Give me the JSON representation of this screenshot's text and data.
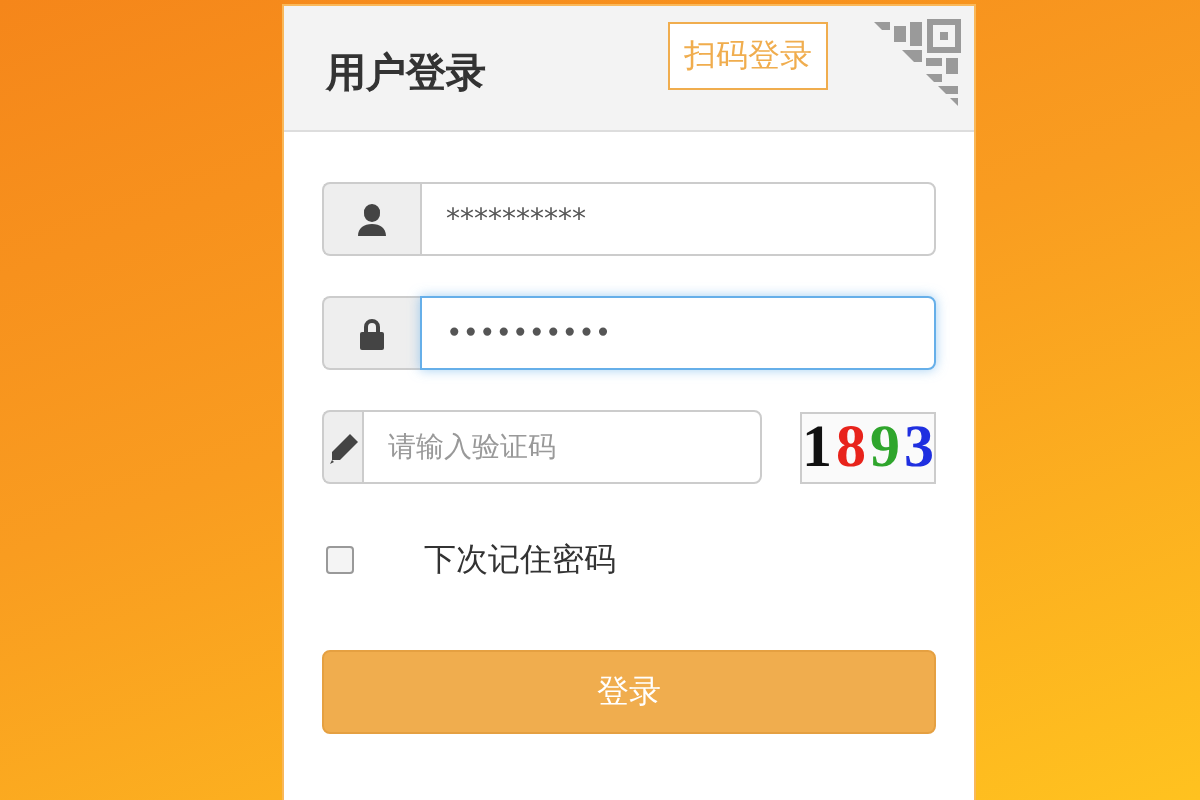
{
  "header": {
    "title": "用户登录",
    "qr_tag": "扫码登录"
  },
  "fields": [
    {
      "kind": "user",
      "value": "**********",
      "focused": false
    },
    {
      "kind": "lock",
      "value": "••••••••••",
      "focused": true
    }
  ],
  "captcha_field": {
    "placeholder": "请输入验证码"
  },
  "captcha": [
    {
      "char": "1",
      "color": "#111111"
    },
    {
      "char": "8",
      "color": "#e8231b"
    },
    {
      "char": "9",
      "color": "#2fa52c"
    },
    {
      "char": "3",
      "color": "#1f2fe0"
    }
  ],
  "remember": {
    "label": "下次记住密码",
    "checked": false
  },
  "login_button": "登录"
}
